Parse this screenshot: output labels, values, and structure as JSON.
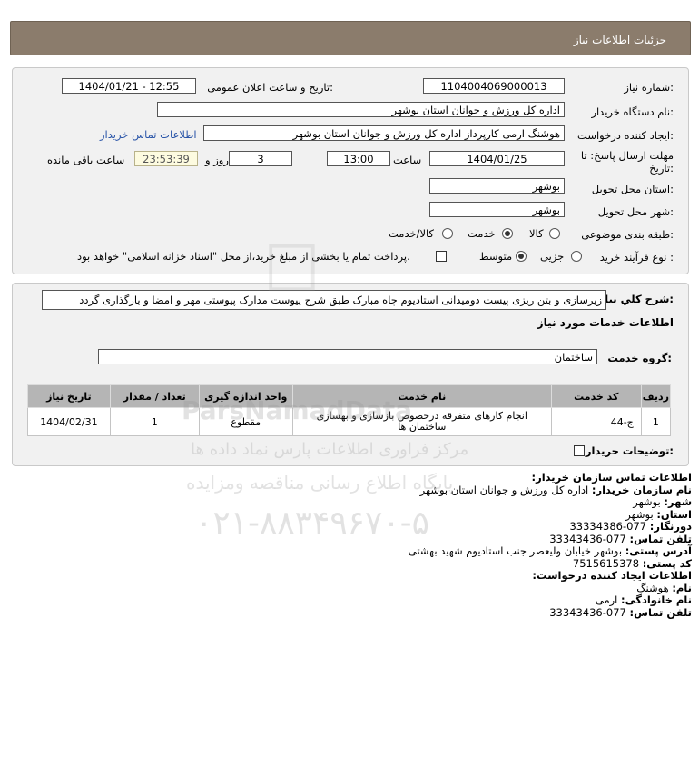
{
  "header": {
    "title": "جزئیات اطلاعات نیاز"
  },
  "form": {
    "need_number_label": "شماره نیاز:",
    "need_number": "1104004069000013",
    "announce_label": "تاریخ و ساعت اعلان عمومی:",
    "announce_value": "1404/01/21 - 12:55",
    "buyer_org_label": "نام دستگاه خریدار:",
    "buyer_org": "اداره کل ورزش و جوانان استان بوشهر",
    "creator_label": "ایجاد کننده درخواست:",
    "creator": "هوشنگ ارمی کارپرداز اداره کل ورزش و جوانان استان بوشهر",
    "contact_link": "اطلاعات تماس خریدار",
    "deadline_label_1": "مهلت ارسال پاسخ: تا",
    "deadline_label_2": "تاریخ:",
    "deadline_date": "1404/01/25",
    "time_label": "ساعت",
    "deadline_time": "13:00",
    "days_value": "3",
    "days_label": "روز و",
    "remaining_time": "23:53:39",
    "remaining_label": "ساعت باقی مانده",
    "province_label": "استان محل تحویل:",
    "province": "بوشهر",
    "city_label": "شهر محل تحویل:",
    "city": "بوشهر",
    "category_label": "طبقه بندی موضوعی:",
    "category_options": [
      "کالا",
      "خدمت",
      "کالا/خدمت"
    ],
    "category_selected": "خدمت",
    "process_label": "نوع فرآیند خرید :",
    "process_options": [
      "جزیی",
      "متوسط"
    ],
    "process_selected": "متوسط",
    "payment_note": "پرداخت تمام یا بخشی از مبلغ خرید،از محل \"اسناد خزانه اسلامی\" خواهد بود."
  },
  "description": {
    "label": "شرح کلي نياز:",
    "text": "زیرسازی و بتن ریزی پیست دومیدانی استادیوم چاه مبارک طبق شرح پیوست مدارک پیوستی مهر و امضا و بارگذاری گردد"
  },
  "services": {
    "section_title": "اطلاعات خدمات مورد نیاز",
    "group_label": "گروه خدمت:",
    "group_value": "ساختمان",
    "columns": [
      "ردیف",
      "کد خدمت",
      "نام خدمت",
      "واحد اندازه گیری",
      "تعداد / مقدار",
      "تاریخ نیاز"
    ],
    "rows": [
      {
        "row": "1",
        "code": "ج-44",
        "name": "انجام کارهای متفرقه درخصوص بازسازی و بهسازی ساختمان ها",
        "unit": "مقطوع",
        "qty": "1",
        "date": "1404/02/31"
      }
    ]
  },
  "buyer_notes_label": "توضیحات خریدار:",
  "contact": {
    "title": "اطلاعات تماس سازمان خریدار:",
    "org_key": "نام سازمان خریدار:",
    "org_val": "اداره کل ورزش و جوانان استان بوشهر",
    "city_key": "شهر:",
    "city_val": "بوشهر",
    "province_key": "استان:",
    "province_val": "بوشهر",
    "fax_key": "دورنگار:",
    "fax_val": "077-33334386",
    "phone_key": "تلفن تماس:",
    "phone_val": "077-33343436",
    "address_key": "آدرس پستی:",
    "address_val": "بوشهر خیابان ولیعصر جنب استادیوم شهید بهشتی",
    "postal_key": "کد پستی:",
    "postal_val": "7515615378",
    "creator_title": "اطلاعات ایجاد کننده درخواست:",
    "name_key": "نام:",
    "name_val": "هوشنگ",
    "family_key": "نام خانوادگی:",
    "family_val": "ارمی",
    "phone2_key": "تلفن تماس:",
    "phone2_val": "077-33343436"
  },
  "watermark": {
    "brand": "ParsNamadData",
    "line1": "مرکز فراوری اطلاعات پارس نماد داده ها",
    "line2": "پایگاه اطلاع رسانی مناقصه ومزایده",
    "phone": "۰۲۱-۸۸۳۴۹۶۷۰-۵"
  }
}
